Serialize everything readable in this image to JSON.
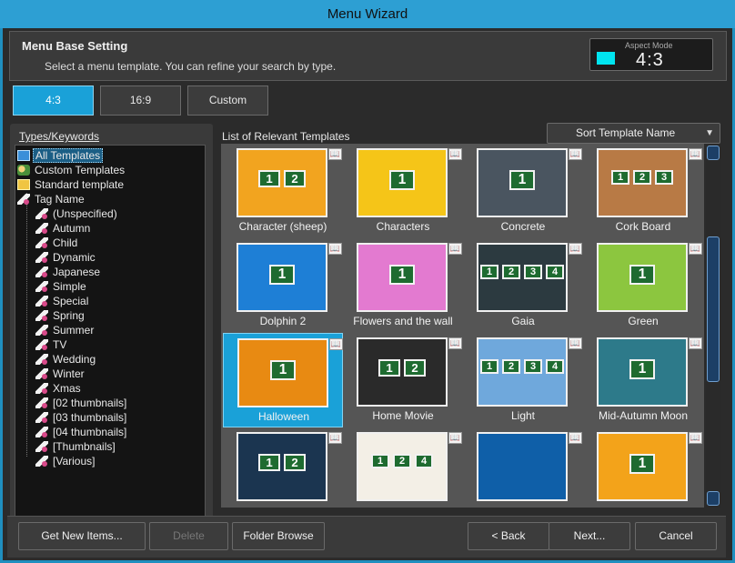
{
  "window": {
    "title": "Menu Wizard"
  },
  "header": {
    "title": "Menu Base Setting",
    "subtitle": "Select a menu template. You can refine your search by type.",
    "aspect_label": "Aspect Mode",
    "aspect_value": "4:3",
    "aspect_color": "#00e5f0"
  },
  "tabs": [
    {
      "label": "4:3",
      "active": true
    },
    {
      "label": "16:9",
      "active": false
    },
    {
      "label": "Custom",
      "active": false
    }
  ],
  "types_panel": {
    "label": "Types/Keywords",
    "items": [
      {
        "label": "All Templates",
        "icon": "all-templates-icon",
        "selected": true,
        "indent": 0
      },
      {
        "label": "Custom Templates",
        "icon": "custom-templates-icon",
        "indent": 0
      },
      {
        "label": "Standard template",
        "icon": "standard-template-icon",
        "indent": 0
      },
      {
        "label": "Tag Name",
        "icon": "tag-icon",
        "indent": 0
      },
      {
        "label": "(Unspecified)",
        "icon": "tag-icon",
        "indent": 1
      },
      {
        "label": "Autumn",
        "icon": "tag-icon",
        "indent": 1
      },
      {
        "label": "Child",
        "icon": "tag-icon",
        "indent": 1
      },
      {
        "label": "Dynamic",
        "icon": "tag-icon",
        "indent": 1
      },
      {
        "label": "Japanese",
        "icon": "tag-icon",
        "indent": 1
      },
      {
        "label": "Simple",
        "icon": "tag-icon",
        "indent": 1
      },
      {
        "label": "Special",
        "icon": "tag-icon",
        "indent": 1
      },
      {
        "label": "Spring",
        "icon": "tag-icon",
        "indent": 1
      },
      {
        "label": "Summer",
        "icon": "tag-icon",
        "indent": 1
      },
      {
        "label": "TV",
        "icon": "tag-icon",
        "indent": 1
      },
      {
        "label": "Wedding",
        "icon": "tag-icon",
        "indent": 1
      },
      {
        "label": "Winter",
        "icon": "tag-icon",
        "indent": 1
      },
      {
        "label": "Xmas",
        "icon": "tag-icon",
        "indent": 1
      },
      {
        "label": "[02 thumbnails]",
        "icon": "tag-icon",
        "indent": 1
      },
      {
        "label": "[03 thumbnails]",
        "icon": "tag-icon",
        "indent": 1
      },
      {
        "label": "[04 thumbnails]",
        "icon": "tag-icon",
        "indent": 1
      },
      {
        "label": "[Thumbnails]",
        "icon": "tag-icon",
        "indent": 1
      },
      {
        "label": "[Various]",
        "icon": "tag-icon",
        "indent": 1
      }
    ]
  },
  "templates_panel": {
    "label": "List of Relevant Templates",
    "sort_value": "Sort Template Name",
    "items": [
      {
        "name": "Character (sheep)",
        "bg": "#f2a41f",
        "tiles": [
          "1",
          "2"
        ],
        "selected": false
      },
      {
        "name": "Characters",
        "bg": "#f5c518",
        "tiles": [
          "1"
        ],
        "selected": false
      },
      {
        "name": "Concrete",
        "bg": "#4a5560",
        "tiles": [
          "1"
        ],
        "selected": false
      },
      {
        "name": "Cork Board",
        "bg": "#b87a45",
        "tiles": [
          "1",
          "2",
          "3"
        ],
        "selected": false
      },
      {
        "name": "Dolphin 2",
        "bg": "#1e7fd6",
        "tiles": [
          "1"
        ],
        "selected": false
      },
      {
        "name": "Flowers and the wall",
        "bg": "#e37ad0",
        "tiles": [
          "1"
        ],
        "selected": false
      },
      {
        "name": "Gaia",
        "bg": "#2c3a40",
        "tiles": [
          "1",
          "2",
          "3",
          "4"
        ],
        "selected": false
      },
      {
        "name": "Green",
        "bg": "#8cc63f",
        "tiles": [
          "1"
        ],
        "selected": false
      },
      {
        "name": "Halloween",
        "bg": "#e88a12",
        "tiles": [
          "1"
        ],
        "selected": true
      },
      {
        "name": "Home Movie",
        "bg": "#2a2a2a",
        "tiles": [
          "1",
          "2"
        ],
        "selected": false
      },
      {
        "name": "Light",
        "bg": "#6fa8dc",
        "tiles": [
          "1",
          "2",
          "3",
          "4"
        ],
        "selected": false
      },
      {
        "name": "Mid-Autumn Moon",
        "bg": "#2d7a8a",
        "tiles": [
          "1"
        ],
        "selected": false
      },
      {
        "name": "",
        "bg": "#1b3550",
        "tiles": [
          "1",
          "2"
        ],
        "selected": false
      },
      {
        "name": "",
        "bg": "#f3efe6",
        "tiles": [
          "1",
          "2",
          "4"
        ],
        "selected": false
      },
      {
        "name": "",
        "bg": "#0f5fa8",
        "tiles": [],
        "selected": false
      },
      {
        "name": "",
        "bg": "#f3a31a",
        "tiles": [
          "1"
        ],
        "selected": false
      }
    ]
  },
  "footer": {
    "get_new": "Get New Items...",
    "delete": "Delete",
    "folder_browse": "Folder Browse",
    "back": "< Back",
    "next": "Next...",
    "cancel": "Cancel"
  }
}
